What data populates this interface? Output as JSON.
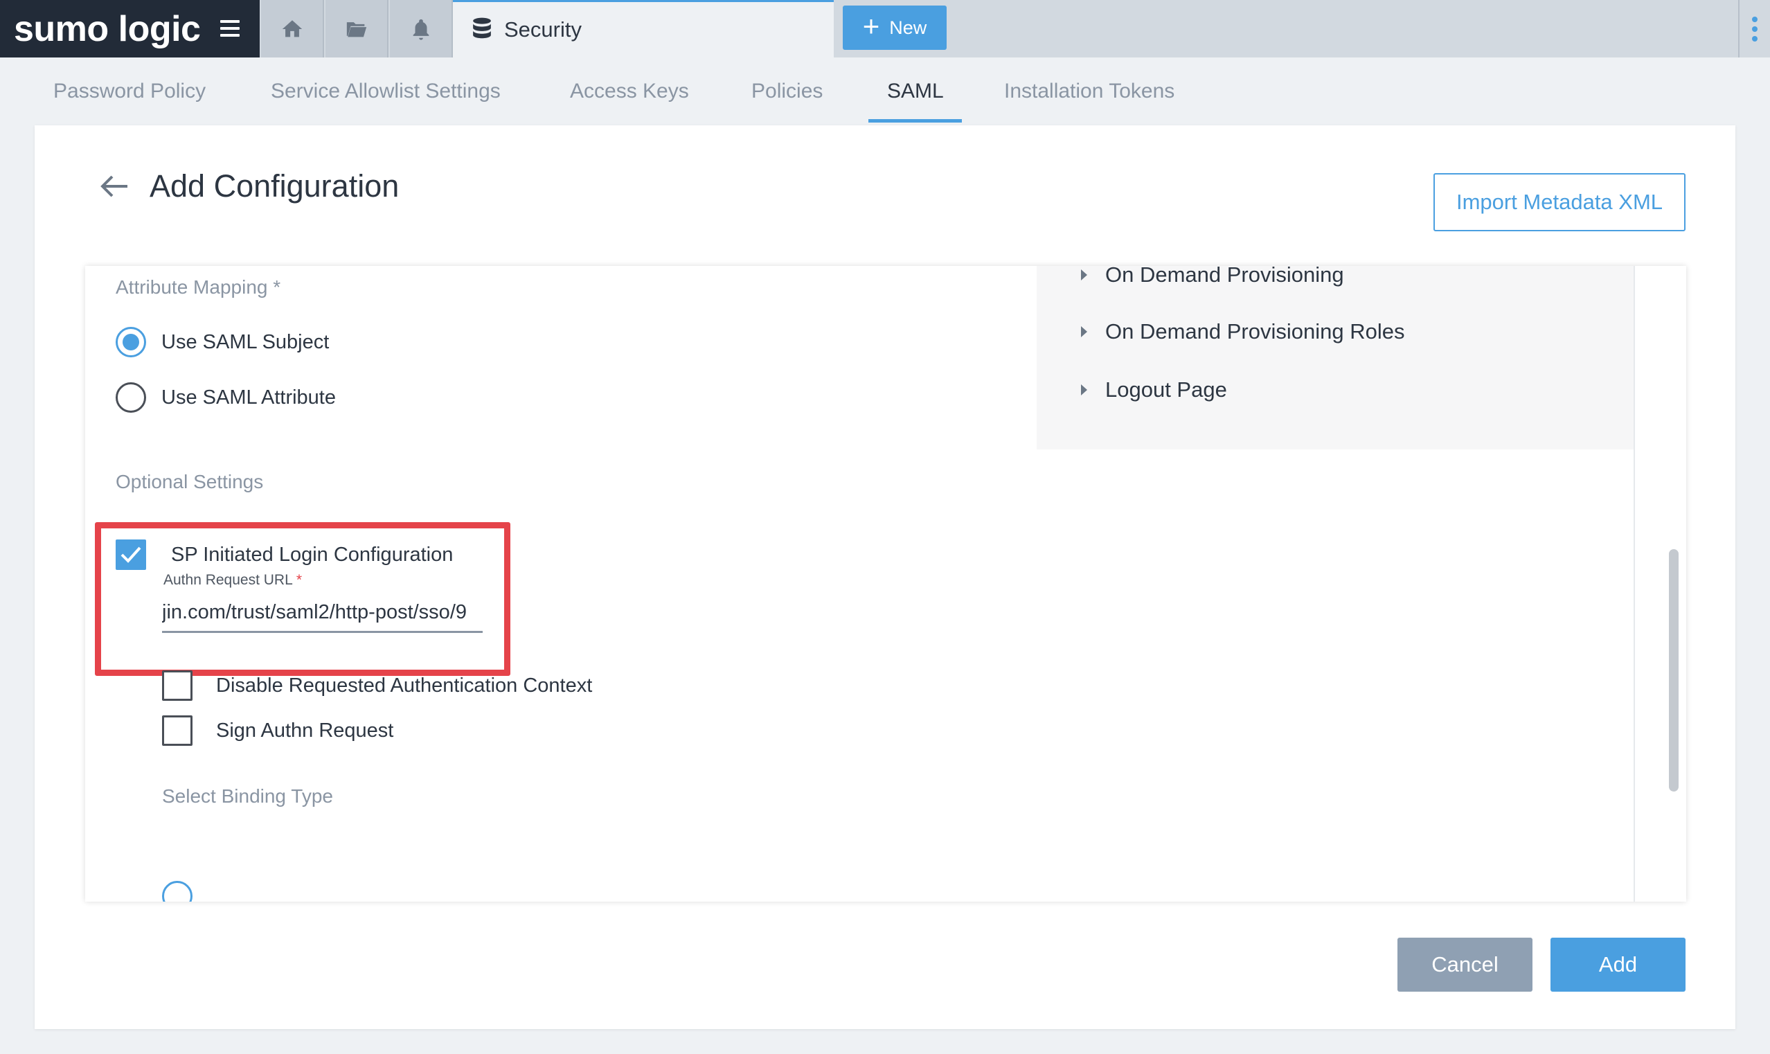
{
  "brand": {
    "logo_text": "sumo logic"
  },
  "topbar": {
    "nav_icons": [
      "home-icon",
      "folder-icon",
      "bell-icon"
    ],
    "active_tab": {
      "label": "Security",
      "icon": "database-icon"
    },
    "new_button": {
      "label": "New",
      "icon": "plus-icon"
    },
    "menu_icon": "kebab-menu-icon"
  },
  "subtabs": [
    {
      "label": "Password Policy",
      "active": false
    },
    {
      "label": "Service Allowlist Settings",
      "active": false
    },
    {
      "label": "Access Keys",
      "active": false
    },
    {
      "label": "Policies",
      "active": false
    },
    {
      "label": "SAML",
      "active": true
    },
    {
      "label": "Installation Tokens",
      "active": false
    }
  ],
  "page": {
    "title": "Add Configuration",
    "import_button": "Import Metadata XML"
  },
  "form": {
    "attribute_mapping": {
      "label": "Attribute Mapping *",
      "options": [
        {
          "label": "Use SAML Subject",
          "checked": true
        },
        {
          "label": "Use SAML Attribute",
          "checked": false
        }
      ]
    },
    "expandables": [
      "On Demand Provisioning",
      "On Demand Provisioning Roles",
      "Logout Page"
    ],
    "optional_settings": {
      "label": "Optional Settings",
      "sp_initiated": {
        "label": "SP Initiated Login Configuration",
        "checked": true,
        "field_label": "Authn Request URL",
        "required_mark": "*",
        "value": "jin.com/trust/saml2/http-post/sso/9"
      },
      "checkboxes": [
        {
          "label": "Disable Requested Authentication Context",
          "checked": false
        },
        {
          "label": "Sign Authn Request",
          "checked": false
        }
      ],
      "binding_label": "Select Binding Type"
    }
  },
  "footer": {
    "cancel": "Cancel",
    "add": "Add"
  },
  "colors": {
    "accent": "#4a9fe0",
    "highlight": "#e5434a",
    "brand_bg": "#222b38"
  }
}
